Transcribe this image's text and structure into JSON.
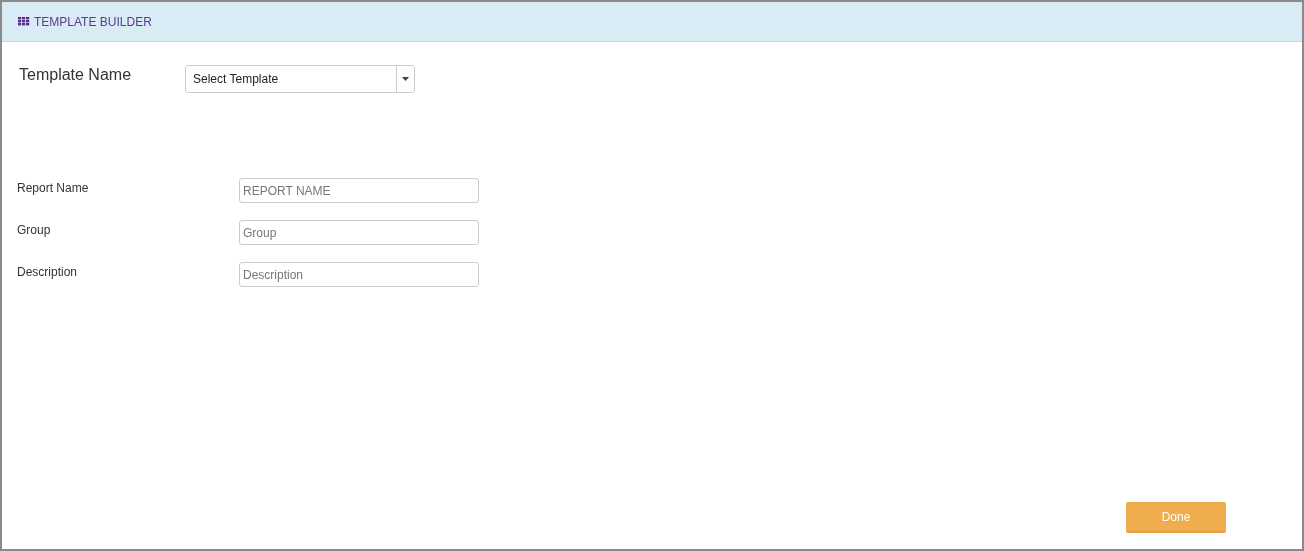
{
  "header": {
    "title": "TEMPLATE BUILDER"
  },
  "template": {
    "label": "Template Name",
    "value": "Select Template"
  },
  "fields": [
    {
      "label": "Report Name",
      "placeholder": "REPORT NAME"
    },
    {
      "label": "Group",
      "placeholder": "Group"
    },
    {
      "label": "Description",
      "placeholder": "Description"
    }
  ],
  "done_button": "Done"
}
